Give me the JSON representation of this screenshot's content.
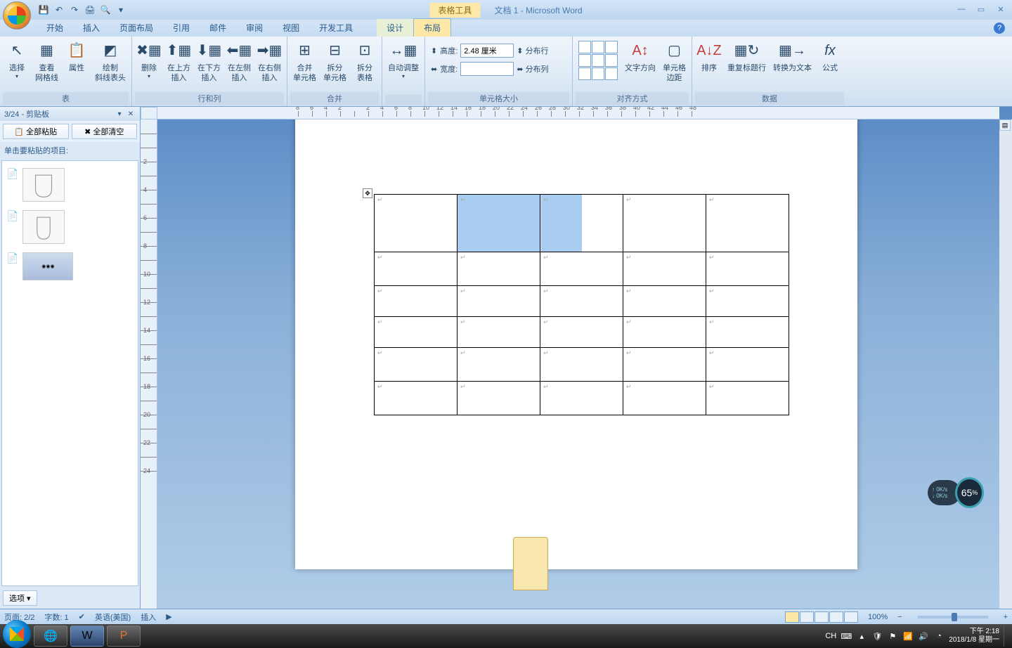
{
  "title": {
    "contextual_tab": "表格工具",
    "document": "文档 1 - Microsoft Word"
  },
  "qat": {
    "save": "💾",
    "undo": "↶",
    "redo": "↷",
    "quickprint": "🖨",
    "preview": "🔍"
  },
  "tabs": [
    "开始",
    "插入",
    "页面布局",
    "引用",
    "邮件",
    "审阅",
    "视图",
    "开发工具"
  ],
  "context_tabs": {
    "design": "设计",
    "layout": "布局"
  },
  "ribbon": {
    "groups": {
      "table": {
        "label": "表",
        "select": "选择",
        "gridlines": "查看\n网格线",
        "properties": "属性",
        "draw": "绘制\n斜线表头"
      },
      "rowscols": {
        "label": "行和列",
        "delete": "删除",
        "insert_above": "在上方\n插入",
        "insert_below": "在下方\n插入",
        "insert_left": "在左侧\n插入",
        "insert_right": "在右侧\n插入"
      },
      "merge": {
        "label": "合并",
        "merge_cells": "合并\n单元格",
        "split_cells": "拆分\n单元格",
        "split_table": "拆分\n表格"
      },
      "autofit": {
        "label": "",
        "autofit": "自动调整"
      },
      "cellsize": {
        "label": "单元格大小",
        "height": "高度:",
        "height_val": "2.48 厘米",
        "width": "宽度:",
        "width_val": "",
        "dist_rows": "分布行",
        "dist_cols": "分布列"
      },
      "alignment": {
        "label": "对齐方式",
        "text_dir": "文字方向",
        "cell_margins": "单元格\n边距"
      },
      "data": {
        "label": "数据",
        "sort": "排序",
        "repeat_header": "重复标题行",
        "to_text": "转换为文本",
        "formula": "公式"
      }
    }
  },
  "clipboard_pane": {
    "header": "3/24 - 剪贴板",
    "paste_all": "全部粘贴",
    "clear_all": "全部清空",
    "hint": "单击要粘贴的项目:",
    "options": "选项"
  },
  "statusbar": {
    "page": "页面: 2/2",
    "words": "字数: 1",
    "lang": "英语(美国)",
    "insert": "插入",
    "zoom": "100%"
  },
  "taskbar": {
    "lang": "CH",
    "time": "下午 2:18",
    "date": "2018/1/8 星期一"
  },
  "widget": {
    "up": "0K/s",
    "down": "0K/s",
    "pct": "65"
  },
  "ruler_marks": [
    8,
    6,
    4,
    2,
    "",
    2,
    4,
    6,
    8,
    10,
    12,
    14,
    16,
    18,
    20,
    22,
    24,
    26,
    28,
    30,
    32,
    34,
    36,
    38,
    40,
    42,
    44,
    46,
    48
  ],
  "vruler_marks": [
    "",
    "",
    "2",
    "",
    "4",
    "",
    "6",
    "",
    "8",
    "",
    "10",
    "",
    "12",
    "",
    "14",
    "",
    "16",
    "",
    "18",
    "",
    "20",
    "",
    "22",
    "",
    "24"
  ]
}
